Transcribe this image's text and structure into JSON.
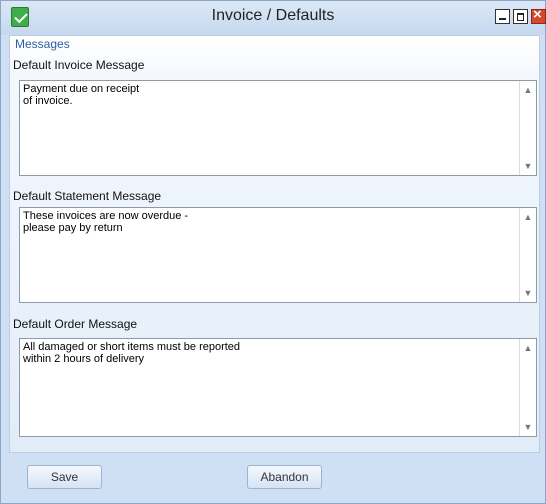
{
  "window": {
    "title": "Invoice / Defaults",
    "controls": [
      "minimize-icon",
      "maximize-icon",
      "close-icon"
    ]
  },
  "panel": {
    "header": "Messages",
    "sections": [
      {
        "label": "Default Invoice Message",
        "text": "Payment due on receipt\nof invoice."
      },
      {
        "label": "Default Statement Message",
        "text": "These invoices are now overdue -\nplease pay by return"
      },
      {
        "label": "Default Order Message",
        "text": "All damaged or short items must be reported\nwithin 2 hours of delivery"
      }
    ]
  },
  "buttons": {
    "save": "Save",
    "abandon": "Abandon"
  },
  "icons": {
    "scroll_up": "▲",
    "scroll_down": "▼"
  },
  "colors": {
    "titlebar": "#c6d8ef",
    "close_button": "#d4482c",
    "panel_header_text": "#2d5fa0"
  }
}
